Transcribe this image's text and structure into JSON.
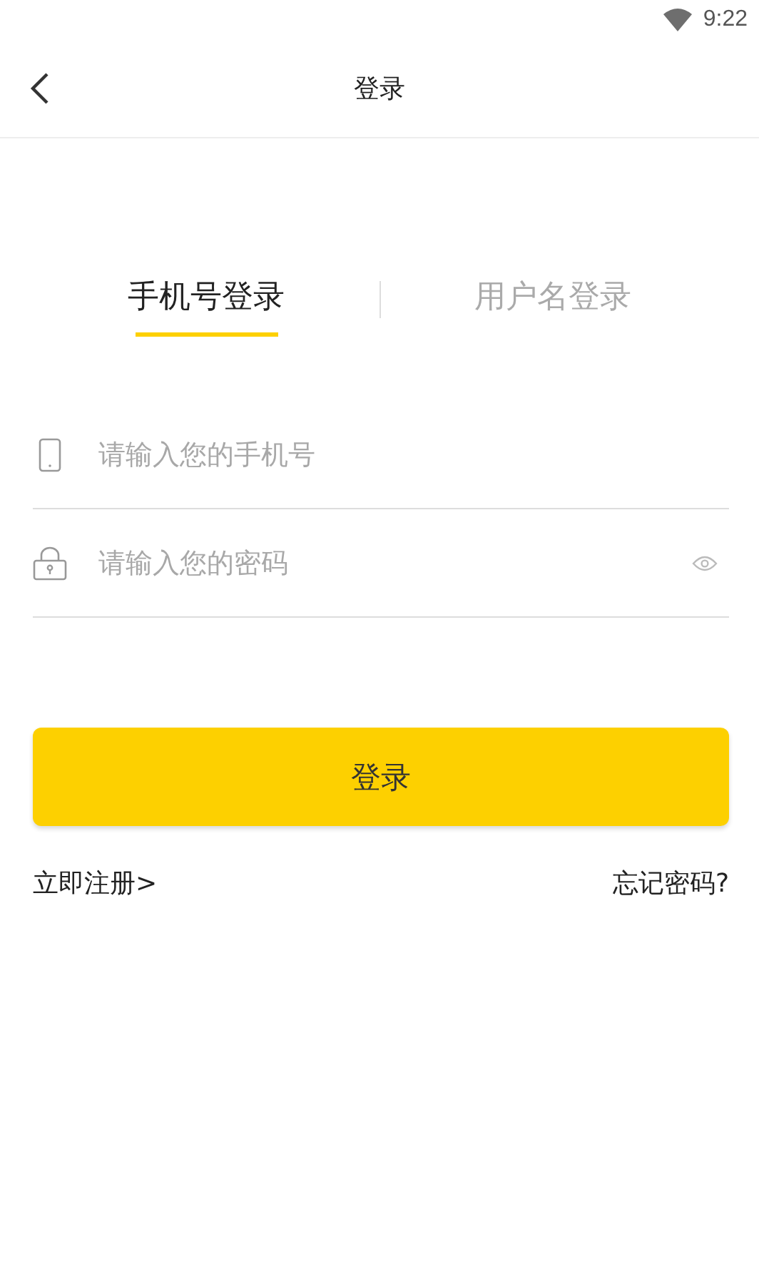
{
  "status_bar": {
    "time": "9:22"
  },
  "header": {
    "title": "登录"
  },
  "tabs": [
    {
      "label": "手机号登录",
      "selected": true
    },
    {
      "label": "用户名登录",
      "selected": false
    }
  ],
  "fields": [
    {
      "kind": "phone",
      "placeholder": "请输入您的手机号"
    },
    {
      "kind": "password",
      "placeholder": "请输入您的密码"
    }
  ],
  "submit": {
    "label": "登录"
  },
  "links": {
    "register": "立即注册>",
    "forgot": "忘记密码?"
  }
}
